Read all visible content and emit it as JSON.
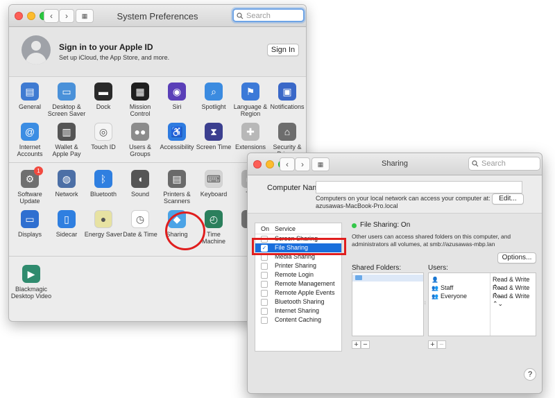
{
  "system_preferences": {
    "title": "System Preferences",
    "search_placeholder": "Search",
    "apple_id": {
      "title": "Sign in to your Apple ID",
      "subtitle": "Set up iCloud, the App Store, and more.",
      "sign_in_label": "Sign In"
    },
    "row1": [
      {
        "label": "General",
        "icon": "general-icon",
        "color": "#3f7bd2"
      },
      {
        "label": "Desktop & Screen Saver",
        "icon": "desktop-icon",
        "color": "#4a91d9"
      },
      {
        "label": "Dock",
        "icon": "dock-icon",
        "color": "#2a2a2a"
      },
      {
        "label": "Mission Control",
        "icon": "mission-control-icon",
        "color": "#1f1f1f"
      },
      {
        "label": "Siri",
        "icon": "siri-icon",
        "color": "#5a3fb8"
      },
      {
        "label": "Spotlight",
        "icon": "spotlight-icon",
        "color": "#3b8be0"
      },
      {
        "label": "Language & Region",
        "icon": "language-icon",
        "color": "#3c7ad8"
      },
      {
        "label": "Notifications",
        "icon": "notifications-icon",
        "color": "#3a68c8"
      }
    ],
    "row2": [
      {
        "label": "Internet Accounts",
        "icon": "at-icon",
        "color": "#3b8de3"
      },
      {
        "label": "Wallet & Apple Pay",
        "icon": "wallet-icon",
        "color": "#555"
      },
      {
        "label": "Touch ID",
        "icon": "fingerprint-icon",
        "color": "#f4f4f4"
      },
      {
        "label": "Users & Groups",
        "icon": "users-icon",
        "color": "#8c8c8c"
      },
      {
        "label": "Accessibility",
        "icon": "accessibility-icon",
        "color": "#2e7be0"
      },
      {
        "label": "Screen Time",
        "icon": "hourglass-icon",
        "color": "#3b3f8f"
      },
      {
        "label": "Extensions",
        "icon": "puzzle-icon",
        "color": "#b8b8b8"
      },
      {
        "label": "Security & Privacy",
        "icon": "house-lock-icon",
        "color": "#6d6d6d"
      }
    ],
    "row3": [
      {
        "label": "Software Update",
        "icon": "gear-icon",
        "color": "#6f6f6f",
        "badge": "1"
      },
      {
        "label": "Network",
        "icon": "globe-icon",
        "color": "#4c6fa6"
      },
      {
        "label": "Bluetooth",
        "icon": "bluetooth-icon",
        "color": "#2f7fe0"
      },
      {
        "label": "Sound",
        "icon": "speaker-icon",
        "color": "#555"
      },
      {
        "label": "Printers & Scanners",
        "icon": "printer-icon",
        "color": "#6a6a6a"
      },
      {
        "label": "Keyboard",
        "icon": "keyboard-icon",
        "color": "#d4d4d4"
      },
      {
        "label": "Tra",
        "icon": "trackpad-icon",
        "color": "#bdbdbd"
      }
    ],
    "row4": [
      {
        "label": "Displays",
        "icon": "display-icon",
        "color": "#2f6fd0"
      },
      {
        "label": "Sidecar",
        "icon": "sidecar-icon",
        "color": "#2f7fe0"
      },
      {
        "label": "Energy Saver",
        "icon": "bulb-icon",
        "color": "#e7e2a2"
      },
      {
        "label": "Date & Time",
        "icon": "clock-icon",
        "color": "#ffffff"
      },
      {
        "label": "Sharing",
        "icon": "sharing-folder-icon",
        "color": "#4ba3e6"
      },
      {
        "label": "Time Machine",
        "icon": "time-machine-icon",
        "color": "#2b7f5c"
      },
      {
        "label": "S",
        "icon": "startup-disk-icon",
        "color": "#7a7a7a"
      }
    ],
    "row5": [
      {
        "label": "Blackmagic Desktop Video",
        "icon": "blackmagic-icon",
        "color": "#2f8b6e"
      }
    ]
  },
  "sharing": {
    "title": "Sharing",
    "search_placeholder": "Search",
    "computer_name_label": "Computer Name:",
    "computer_name_value": "",
    "local_text": "Computers on your local network can access your computer at:",
    "local_address": "azusawas-MacBook-Pro.local",
    "edit_label": "Edit...",
    "table_headers": {
      "on": "On",
      "service": "Service"
    },
    "services": [
      {
        "name": "Screen Sharing",
        "checked": false,
        "selected": false
      },
      {
        "name": "File Sharing",
        "checked": true,
        "selected": true
      },
      {
        "name": "Media Sharing",
        "checked": false,
        "selected": false
      },
      {
        "name": "Printer Sharing",
        "checked": false,
        "selected": false
      },
      {
        "name": "Remote Login",
        "checked": false,
        "selected": false
      },
      {
        "name": "Remote Management",
        "checked": false,
        "selected": false
      },
      {
        "name": "Remote Apple Events",
        "checked": false,
        "selected": false
      },
      {
        "name": "Bluetooth Sharing",
        "checked": false,
        "selected": false
      },
      {
        "name": "Internet Sharing",
        "checked": false,
        "selected": false
      },
      {
        "name": "Content Caching",
        "checked": false,
        "selected": false
      }
    ],
    "status": "File Sharing: On",
    "description": "Other users can access shared folders on this computer, and administrators all volumes, at smb://azusawas-mbp.lan",
    "options_label": "Options...",
    "shared_folders_label": "Shared Folders:",
    "users_label": "Users:",
    "users": [
      {
        "name": "",
        "permission": "Read & Write"
      },
      {
        "name": "Staff",
        "permission": "Read & Write"
      },
      {
        "name": "Everyone",
        "permission": "Read & Write"
      }
    ],
    "plus": "+",
    "minus": "−",
    "help": "?",
    "check_mark": "✓",
    "updown": "⌃⌄"
  }
}
